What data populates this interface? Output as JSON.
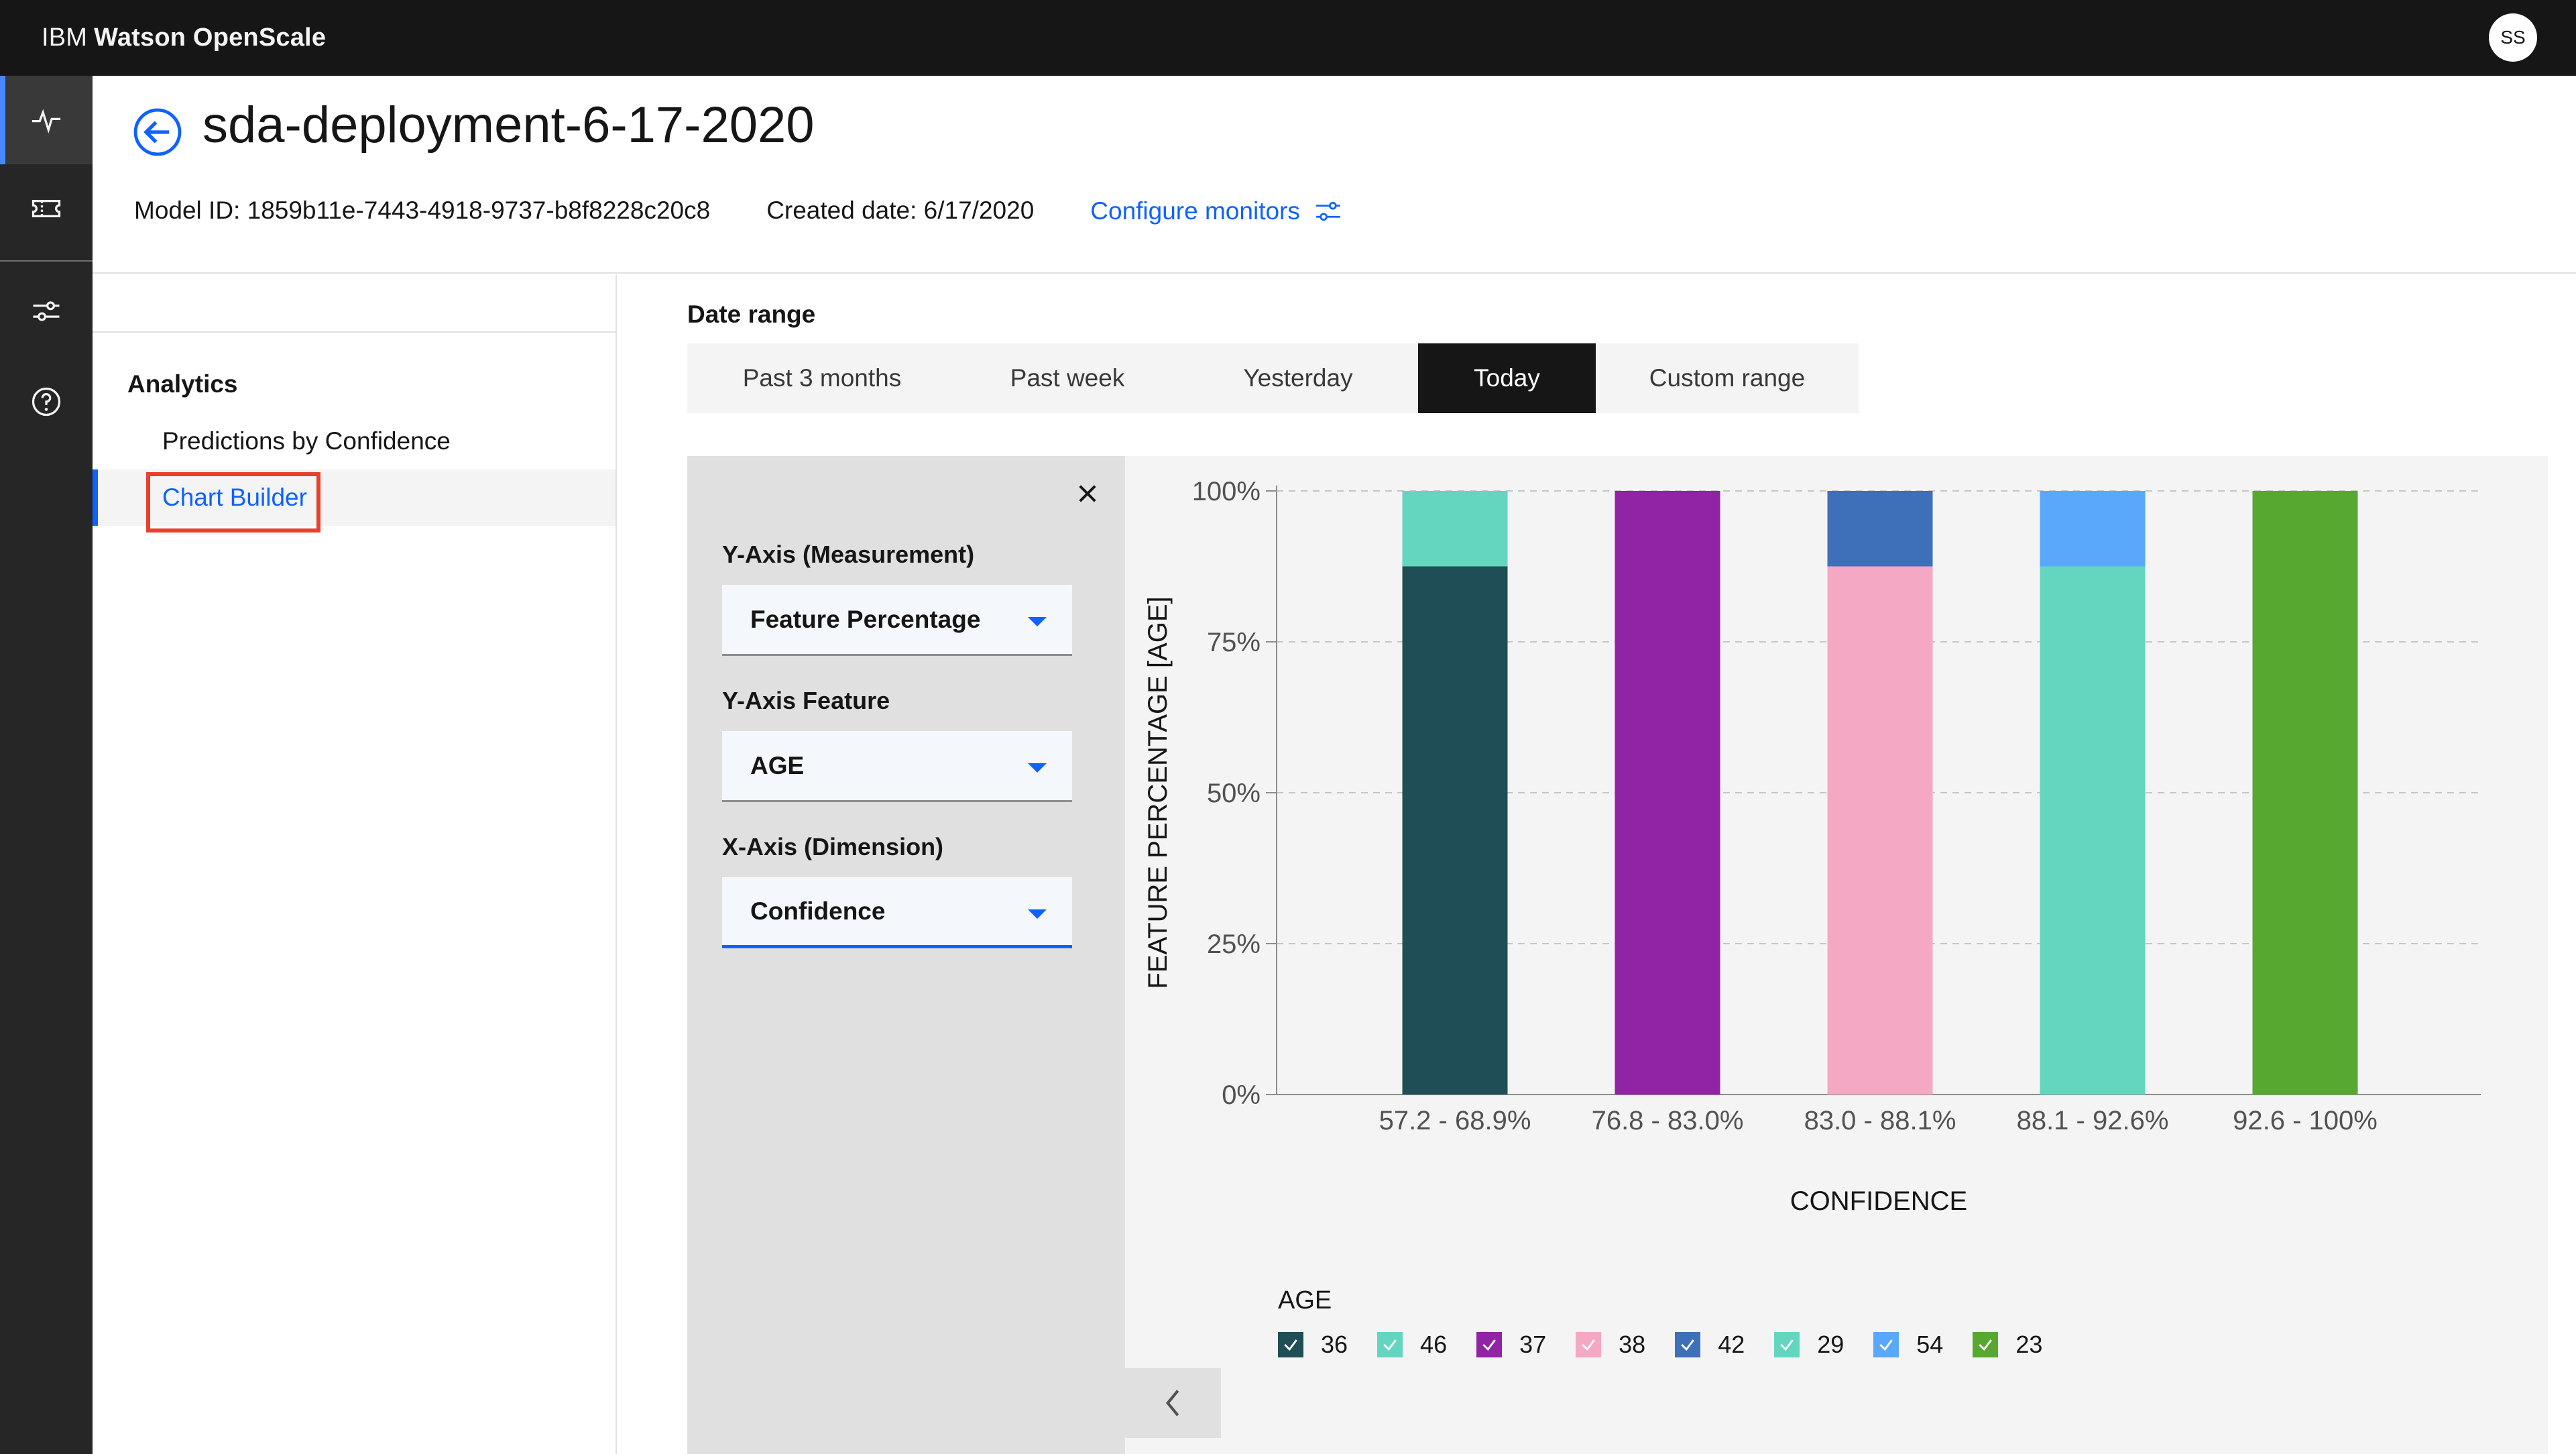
{
  "app": {
    "brand_prefix": "IBM",
    "brand_name": "Watson OpenScale",
    "avatar_initials": "SS"
  },
  "header": {
    "title": "sda-deployment-6-17-2020",
    "model_id": "Model ID: 1859b11e-7443-4918-9737-b8f8228c20c8",
    "created_date": "Created date: 6/17/2020",
    "configure_label": "Configure monitors"
  },
  "nav": {
    "heading": "Analytics",
    "items": [
      {
        "label": "Predictions by Confidence"
      },
      {
        "label": "Chart Builder"
      }
    ]
  },
  "date_range": {
    "label": "Date range",
    "tabs": [
      {
        "label": "Past 3 months"
      },
      {
        "label": "Past week"
      },
      {
        "label": "Yesterday"
      },
      {
        "label": "Today"
      },
      {
        "label": "Custom range"
      }
    ],
    "active_tab": "Today"
  },
  "builder": {
    "y_measure_label": "Y-Axis (Measurement)",
    "y_measure_value": "Feature Percentage",
    "y_feature_label": "Y-Axis Feature",
    "y_feature_value": "AGE",
    "x_dim_label": "X-Axis (Dimension)",
    "x_dim_value": "Confidence"
  },
  "chart_data": {
    "type": "bar",
    "stacked": true,
    "ylabel": "FEATURE PERCENTAGE [AGE]",
    "xlabel": "CONFIDENCE",
    "ylim": [
      0,
      100
    ],
    "yticks": [
      "0%",
      "25%",
      "50%",
      "75%",
      "100%"
    ],
    "categories": [
      "57.2 - 68.9%",
      "76.8 - 83.0%",
      "83.0 - 88.1%",
      "88.1 - 92.6%",
      "92.6 - 100%"
    ],
    "series": [
      {
        "name": "36",
        "color": "#1f4e57",
        "values": [
          87.5,
          0,
          0,
          0,
          0
        ]
      },
      {
        "name": "46",
        "color": "#64d6c0",
        "values": [
          12.5,
          0,
          0,
          0,
          0
        ]
      },
      {
        "name": "37",
        "color": "#9123a5",
        "values": [
          0,
          100,
          0,
          0,
          0
        ]
      },
      {
        "name": "38",
        "color": "#f5a8c4",
        "values": [
          0,
          0,
          87.5,
          0,
          0
        ]
      },
      {
        "name": "42",
        "color": "#3d70b8",
        "values": [
          0,
          0,
          12.5,
          0,
          0
        ]
      },
      {
        "name": "29",
        "color": "#64d6c0",
        "values": [
          0,
          0,
          0,
          87.5,
          0
        ]
      },
      {
        "name": "54",
        "color": "#5aa8fc",
        "values": [
          0,
          0,
          0,
          12.5,
          0
        ]
      },
      {
        "name": "23",
        "color": "#56a831",
        "values": [
          0,
          0,
          0,
          0,
          100
        ]
      }
    ],
    "legend_title": "AGE",
    "legend_position": "bottom-left",
    "grid": true
  }
}
